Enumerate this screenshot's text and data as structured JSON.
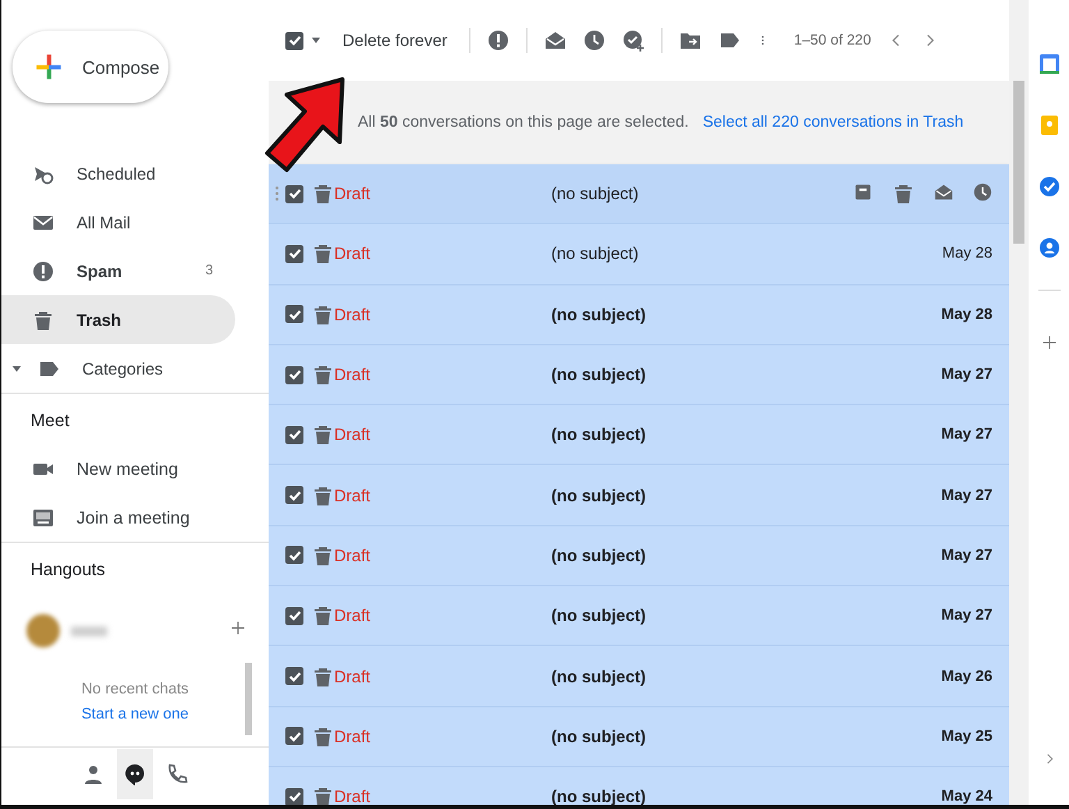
{
  "toolbar": {
    "select_all": {
      "checked": true
    },
    "delete_button": "Delete forever",
    "page_range": "1–50 of 220"
  },
  "banner": {
    "text": "All **50** conversations on this page are selected.",
    "link": "Select all 220 conversations in Trash"
  },
  "compose": "Compose",
  "nav": [
    {
      "kind": "scheduled",
      "label": "Scheduled",
      "unread": false,
      "selected": false
    },
    {
      "kind": "allmail",
      "label": "All Mail",
      "unread": false,
      "selected": false
    },
    {
      "kind": "spam",
      "label": "Spam",
      "count": "3",
      "unread": true,
      "selected": false
    },
    {
      "kind": "trash",
      "label": "Trash",
      "unread": false,
      "selected": true
    },
    {
      "kind": "categories",
      "label": "Categories",
      "unread": false,
      "selected": false
    }
  ],
  "meet": {
    "title": "Meet",
    "items": [
      {
        "kind": "video",
        "label": "New meeting"
      },
      {
        "kind": "keyboard",
        "label": "Join a meeting"
      }
    ]
  },
  "hangouts": {
    "title": "Hangouts",
    "empty_text": "No recent chats",
    "start_link": "Start a new one",
    "tabs": [
      {
        "kind": "contacts",
        "selected": false
      },
      {
        "kind": "chat",
        "selected": true
      },
      {
        "kind": "phone",
        "selected": false
      }
    ]
  },
  "messages": [
    {
      "sender": "Draft",
      "subject": "(no subject)",
      "checked": true,
      "unread": false,
      "hovered": true
    },
    {
      "sender": "Draft",
      "subject": "(no subject)",
      "date": "May 28",
      "checked": true,
      "unread": false,
      "hovered": false
    },
    {
      "sender": "Draft",
      "subject": "(no subject)",
      "date": "May 28",
      "checked": true,
      "unread": true,
      "hovered": false
    },
    {
      "sender": "Draft",
      "subject": "(no subject)",
      "date": "May 27",
      "checked": true,
      "unread": true,
      "hovered": false
    },
    {
      "sender": "Draft",
      "subject": "(no subject)",
      "date": "May 27",
      "checked": true,
      "unread": true,
      "hovered": false
    },
    {
      "sender": "Draft",
      "subject": "(no subject)",
      "date": "May 27",
      "checked": true,
      "unread": true,
      "hovered": false
    },
    {
      "sender": "Draft",
      "subject": "(no subject)",
      "date": "May 27",
      "checked": true,
      "unread": true,
      "hovered": false
    },
    {
      "sender": "Draft",
      "subject": "(no subject)",
      "date": "May 27",
      "checked": true,
      "unread": true,
      "hovered": false
    },
    {
      "sender": "Draft",
      "subject": "(no subject)",
      "date": "May 26",
      "checked": true,
      "unread": true,
      "hovered": false
    },
    {
      "sender": "Draft",
      "subject": "(no subject)",
      "date": "May 25",
      "checked": true,
      "unread": true,
      "hovered": false
    },
    {
      "sender": "Draft",
      "subject": "(no subject)",
      "date": "May 24",
      "checked": true,
      "unread": true,
      "hovered": false
    }
  ]
}
